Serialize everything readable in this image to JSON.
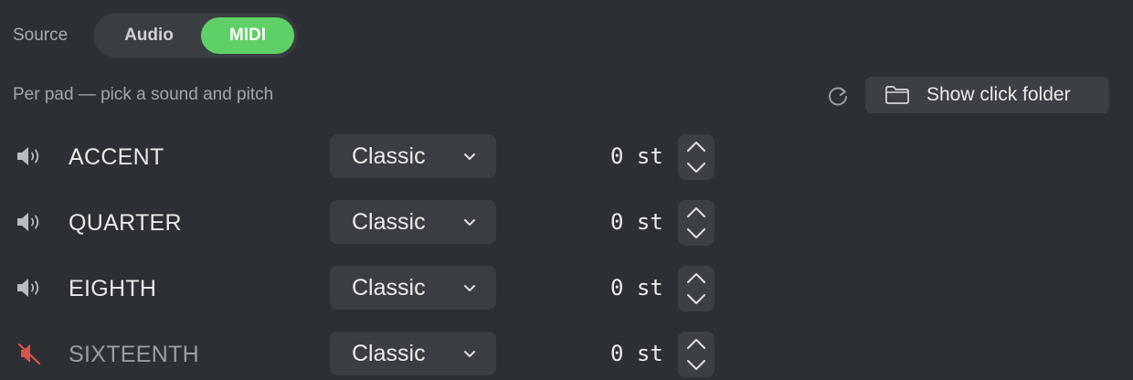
{
  "source": {
    "label": "Source",
    "options": [
      "Audio",
      "MIDI"
    ],
    "selected": "MIDI"
  },
  "header": {
    "hint": "Per pad — pick a sound and pitch",
    "refresh_icon": "refresh-icon",
    "folder_button": {
      "icon": "folder-icon",
      "label": "Show click folder"
    }
  },
  "pads": [
    {
      "name": "ACCENT",
      "muted": false,
      "sound": "Classic",
      "pitch": "0 st"
    },
    {
      "name": "QUARTER",
      "muted": false,
      "sound": "Classic",
      "pitch": "0 st"
    },
    {
      "name": "EIGHTH",
      "muted": false,
      "sound": "Classic",
      "pitch": "0 st"
    },
    {
      "name": "SIXTEENTH",
      "muted": true,
      "sound": "Classic",
      "pitch": "0 st"
    }
  ],
  "colors": {
    "background": "#2c2f33",
    "accent_green": "#5fd067",
    "muted_red": "#d9534f"
  }
}
